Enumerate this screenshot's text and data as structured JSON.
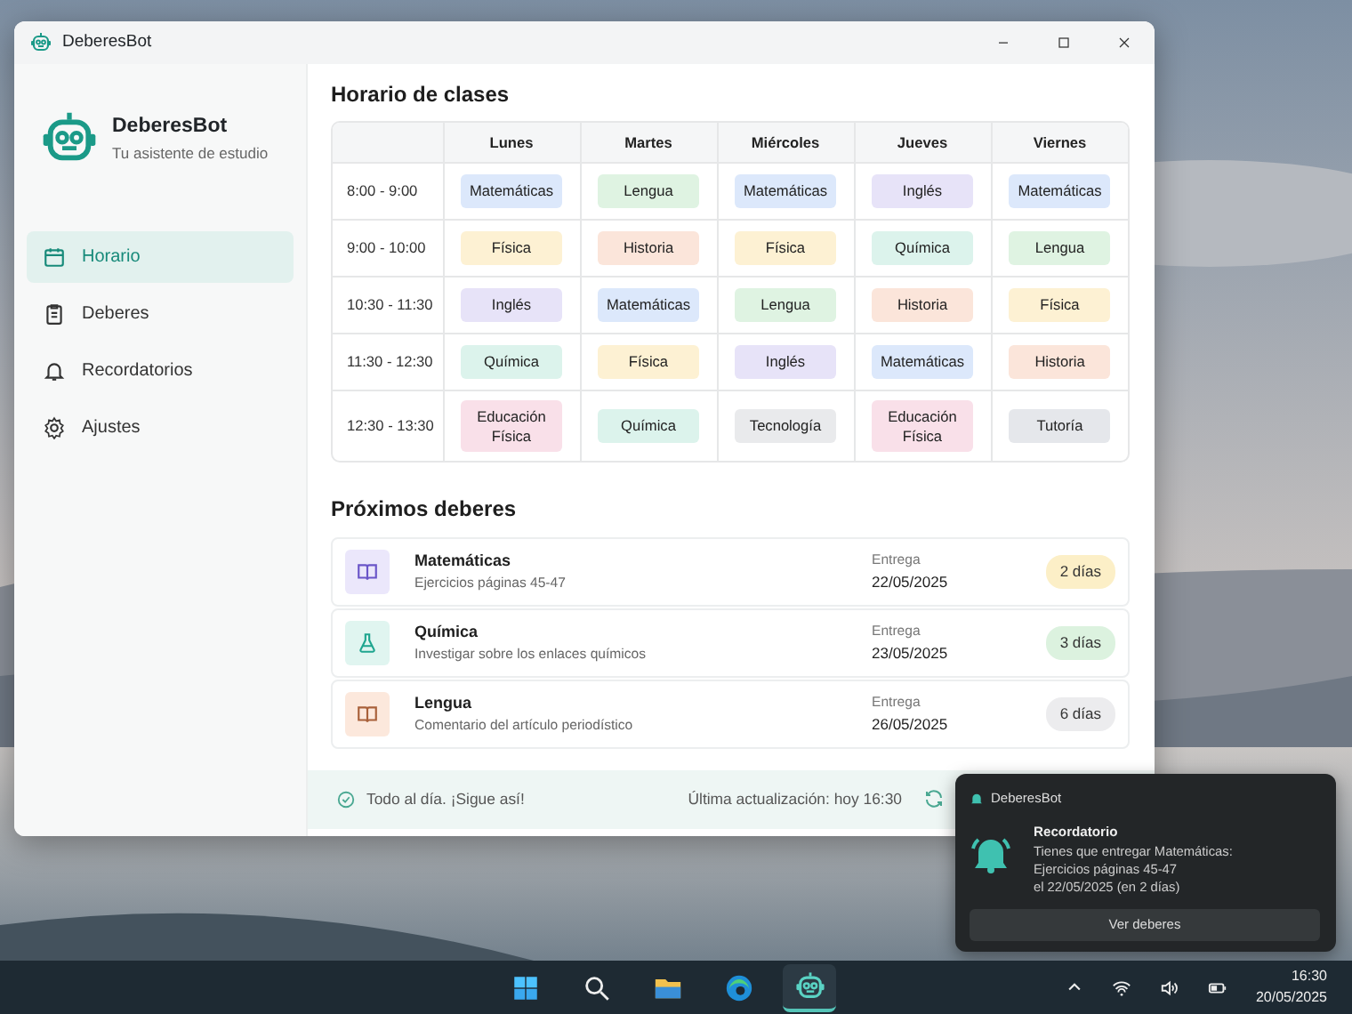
{
  "window": {
    "title": "DeberesBot"
  },
  "sidebar": {
    "app_name": "DeberesBot",
    "tagline": "Tu asistente de estudio",
    "items": [
      {
        "label": "Horario",
        "selected": true
      },
      {
        "label": "Deberes",
        "selected": false
      },
      {
        "label": "Recordatorios",
        "selected": false
      },
      {
        "label": "Ajustes",
        "selected": false
      }
    ]
  },
  "schedule": {
    "title": "Horario de clases",
    "columns": [
      "Lunes",
      "Martes",
      "Miércoles",
      "Jueves",
      "Viernes"
    ],
    "rows": [
      {
        "time": "8:00 - 9:00",
        "cells": [
          {
            "subject": "Matemáticas",
            "color": "#dce8fb"
          },
          {
            "subject": "Lengua",
            "color": "#dff3e2"
          },
          {
            "subject": "Matemáticas",
            "color": "#dce8fb"
          },
          {
            "subject": "Inglés",
            "color": "#e7e3f8"
          },
          {
            "subject": "Matemáticas",
            "color": "#dce8fb"
          }
        ]
      },
      {
        "time": "9:00 - 10:00",
        "cells": [
          {
            "subject": "Física",
            "color": "#fdf1d3"
          },
          {
            "subject": "Historia",
            "color": "#fbe5da"
          },
          {
            "subject": "Física",
            "color": "#fdf1d3"
          },
          {
            "subject": "Química",
            "color": "#dcf3ec"
          },
          {
            "subject": "Lengua",
            "color": "#dff3e2"
          }
        ]
      },
      {
        "time": "10:30 - 11:30",
        "cells": [
          {
            "subject": "Inglés",
            "color": "#e7e3f8"
          },
          {
            "subject": "Matemáticas",
            "color": "#dce8fb"
          },
          {
            "subject": "Lengua",
            "color": "#dff3e2"
          },
          {
            "subject": "Historia",
            "color": "#fbe5da"
          },
          {
            "subject": "Física",
            "color": "#fdf1d3"
          }
        ]
      },
      {
        "time": "11:30 - 12:30",
        "cells": [
          {
            "subject": "Química",
            "color": "#dcf3ec"
          },
          {
            "subject": "Física",
            "color": "#fdf1d3"
          },
          {
            "subject": "Inglés",
            "color": "#e7e3f8"
          },
          {
            "subject": "Matemáticas",
            "color": "#dce8fb"
          },
          {
            "subject": "Historia",
            "color": "#fbe5da"
          }
        ]
      },
      {
        "time": "12:30 - 13:30",
        "cells": [
          {
            "subject": "Educación Física",
            "color": "#f9e0e9"
          },
          {
            "subject": "Química",
            "color": "#dcf3ec"
          },
          {
            "subject": "Tecnología",
            "color": "#e9eaec"
          },
          {
            "subject": "Educación Física",
            "color": "#f9e0e9"
          },
          {
            "subject": "Tutoría",
            "color": "#e5e7eb"
          }
        ]
      }
    ]
  },
  "homework": {
    "title": "Próximos deberes",
    "items": [
      {
        "subject": "Matemáticas",
        "task": "Ejercicios páginas 45-47",
        "due_label": "Entrega",
        "due_date": "22/05/2025",
        "remaining": {
          "text": "2 días",
          "color": "#fcefc7"
        },
        "kind": "book",
        "color": "#ebe7fb"
      },
      {
        "subject": "Química",
        "task": "Investigar sobre los enlaces químicos",
        "due_label": "Entrega",
        "due_date": "23/05/2025",
        "remaining": {
          "text": "3 días",
          "color": "#dcf2df"
        },
        "kind": "flask",
        "color": "#e0f5f0"
      },
      {
        "subject": "Lengua",
        "task": "Comentario del artículo periodístico",
        "due_label": "Entrega",
        "due_date": "26/05/2025",
        "remaining": {
          "text": "6 días",
          "color": "#ececee"
        },
        "kind": "book",
        "color": "#fce8dc"
      }
    ]
  },
  "status_bar": {
    "message": "Todo al día. ¡Sigue así!",
    "updated": "Última actualización: hoy 16:30"
  },
  "notification": {
    "app": "DeberesBot",
    "title": "Recordatorio",
    "lines": [
      "Tienes que entregar Matemáticas:",
      "Ejercicios páginas 45-47",
      "el 22/05/2025 (en 2 días)"
    ],
    "button": "Ver deberes"
  },
  "taskbar": {
    "apps": [
      {
        "selected": false
      },
      {
        "selected": false
      },
      {
        "selected": false
      },
      {
        "selected": false
      },
      {
        "selected": true
      }
    ],
    "time": "16:30",
    "date": "20/05/2025"
  }
}
